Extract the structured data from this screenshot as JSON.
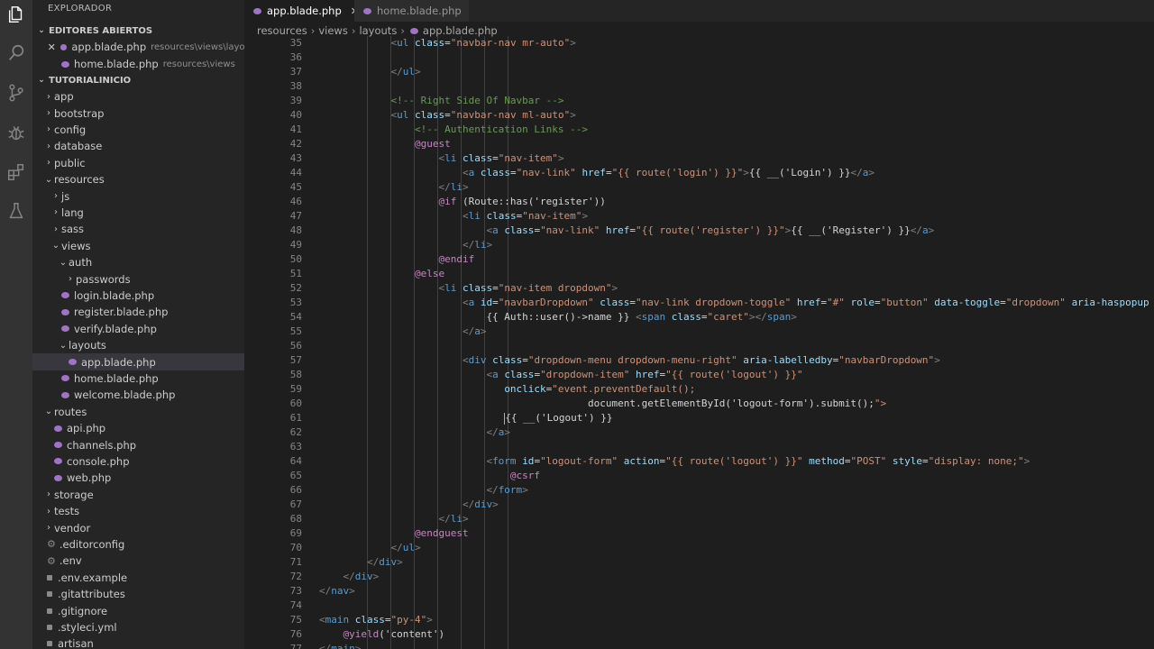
{
  "activity_icons": [
    "files-icon",
    "search-icon",
    "source-control-icon",
    "debug-icon",
    "extensions-icon",
    "test-icon"
  ],
  "sidebar": {
    "title": "EXPLORADOR",
    "open_editors_header": "EDITORES ABIERTOS",
    "open_editors": [
      {
        "name": "app.blade.php",
        "desc": "resources\\views\\layouts"
      },
      {
        "name": "home.blade.php",
        "desc": "resources\\views"
      }
    ],
    "project_header": "TUTORIALINICIO",
    "tree": [
      {
        "label": "app",
        "type": "folder"
      },
      {
        "label": "bootstrap",
        "type": "folder"
      },
      {
        "label": "config",
        "type": "folder"
      },
      {
        "label": "database",
        "type": "folder"
      },
      {
        "label": "public",
        "type": "folder"
      },
      {
        "label": "resources",
        "type": "folder-open"
      },
      {
        "label": "js",
        "type": "folder"
      },
      {
        "label": "lang",
        "type": "folder"
      },
      {
        "label": "sass",
        "type": "folder"
      },
      {
        "label": "views",
        "type": "folder-open"
      },
      {
        "label": "auth",
        "type": "folder-open"
      },
      {
        "label": "passwords",
        "type": "folder"
      },
      {
        "label": "login.blade.php",
        "type": "php"
      },
      {
        "label": "register.blade.php",
        "type": "php"
      },
      {
        "label": "verify.blade.php",
        "type": "php"
      },
      {
        "label": "layouts",
        "type": "folder-open"
      },
      {
        "label": "app.blade.php",
        "type": "php"
      },
      {
        "label": "home.blade.php",
        "type": "php"
      },
      {
        "label": "welcome.blade.php",
        "type": "php"
      },
      {
        "label": "routes",
        "type": "folder-open"
      },
      {
        "label": "api.php",
        "type": "php"
      },
      {
        "label": "channels.php",
        "type": "php"
      },
      {
        "label": "console.php",
        "type": "php"
      },
      {
        "label": "web.php",
        "type": "php"
      },
      {
        "label": "storage",
        "type": "folder"
      },
      {
        "label": "tests",
        "type": "folder"
      },
      {
        "label": "vendor",
        "type": "folder"
      },
      {
        "label": ".editorconfig",
        "type": "gear"
      },
      {
        "label": ".env",
        "type": "gear"
      },
      {
        "label": ".env.example",
        "type": "dot"
      },
      {
        "label": ".gitattributes",
        "type": "dot"
      },
      {
        "label": ".gitignore",
        "type": "dot"
      },
      {
        "label": ".styleci.yml",
        "type": "dot"
      },
      {
        "label": "artisan",
        "type": "dot"
      }
    ]
  },
  "tabs": [
    {
      "label": "app.blade.php",
      "active": true
    },
    {
      "label": "home.blade.php",
      "active": false
    }
  ],
  "breadcrumbs": [
    "resources",
    "views",
    "layouts",
    "app.blade.php"
  ],
  "editor": {
    "lines": [
      {
        "n": "35",
        "t": "            <ul class=\"navbar-nav mr-auto\">"
      },
      {
        "n": "36",
        "t": ""
      },
      {
        "n": "37",
        "t": "            </ul>"
      },
      {
        "n": "38",
        "t": ""
      },
      {
        "n": "39",
        "t": "            <!-- Right Side Of Navbar -->"
      },
      {
        "n": "40",
        "t": "            <ul class=\"navbar-nav ml-auto\">"
      },
      {
        "n": "41",
        "t": "                <!-- Authentication Links -->"
      },
      {
        "n": "42",
        "t": "                @guest"
      },
      {
        "n": "43",
        "t": "                    <li class=\"nav-item\">"
      },
      {
        "n": "44",
        "t": "                        <a class=\"nav-link\" href=\"{{ route('login') }}\">{{ __('Login') }}</a>"
      },
      {
        "n": "45",
        "t": "                    </li>"
      },
      {
        "n": "46",
        "t": "                    @if (Route::has('register'))"
      },
      {
        "n": "47",
        "t": "                        <li class=\"nav-item\">"
      },
      {
        "n": "48",
        "t": "                            <a class=\"nav-link\" href=\"{{ route('register') }}\">{{ __('Register') }}</a>"
      },
      {
        "n": "49",
        "t": "                        </li>"
      },
      {
        "n": "50",
        "t": "                    @endif"
      },
      {
        "n": "51",
        "t": "                @else"
      },
      {
        "n": "52",
        "t": "                    <li class=\"nav-item dropdown\">"
      },
      {
        "n": "53",
        "t": "                        <a id=\"navbarDropdown\" class=\"nav-link dropdown-toggle\" href=\"#\" role=\"button\" data-toggle=\"dropdown\" aria-haspopup"
      },
      {
        "n": "54",
        "t": "                            {{ Auth::user()->name }} <span class=\"caret\"></span>"
      },
      {
        "n": "55",
        "t": "                        </a>"
      },
      {
        "n": "56",
        "t": ""
      },
      {
        "n": "57",
        "t": "                        <div class=\"dropdown-menu dropdown-menu-right\" aria-labelledby=\"navbarDropdown\">"
      },
      {
        "n": "58",
        "t": "                            <a class=\"dropdown-item\" href=\"{{ route('logout') }}\""
      },
      {
        "n": "59",
        "t": "                               onclick=\"event.preventDefault();"
      },
      {
        "n": "60",
        "t": "                                             document.getElementById('logout-form').submit();\">"
      },
      {
        "n": "61",
        "t": "                               {{ __('Logout') }}"
      },
      {
        "n": "62",
        "t": "                            </a>"
      },
      {
        "n": "63",
        "t": ""
      },
      {
        "n": "64",
        "t": "                            <form id=\"logout-form\" action=\"{{ route('logout') }}\" method=\"POST\" style=\"display: none;\">"
      },
      {
        "n": "65",
        "t": "                                @csrf"
      },
      {
        "n": "66",
        "t": "                            </form>"
      },
      {
        "n": "67",
        "t": "                        </div>"
      },
      {
        "n": "68",
        "t": "                    </li>"
      },
      {
        "n": "69",
        "t": "                @endguest"
      },
      {
        "n": "70",
        "t": "            </ul>"
      },
      {
        "n": "71",
        "t": "        </div>"
      },
      {
        "n": "72",
        "t": "    </div>"
      },
      {
        "n": "73",
        "t": "</nav>"
      },
      {
        "n": "74",
        "t": ""
      },
      {
        "n": "75",
        "t": "<main class=\"py-4\">"
      },
      {
        "n": "76",
        "t": "    @yield('content')"
      },
      {
        "n": "77",
        "t": "</main>"
      }
    ]
  }
}
